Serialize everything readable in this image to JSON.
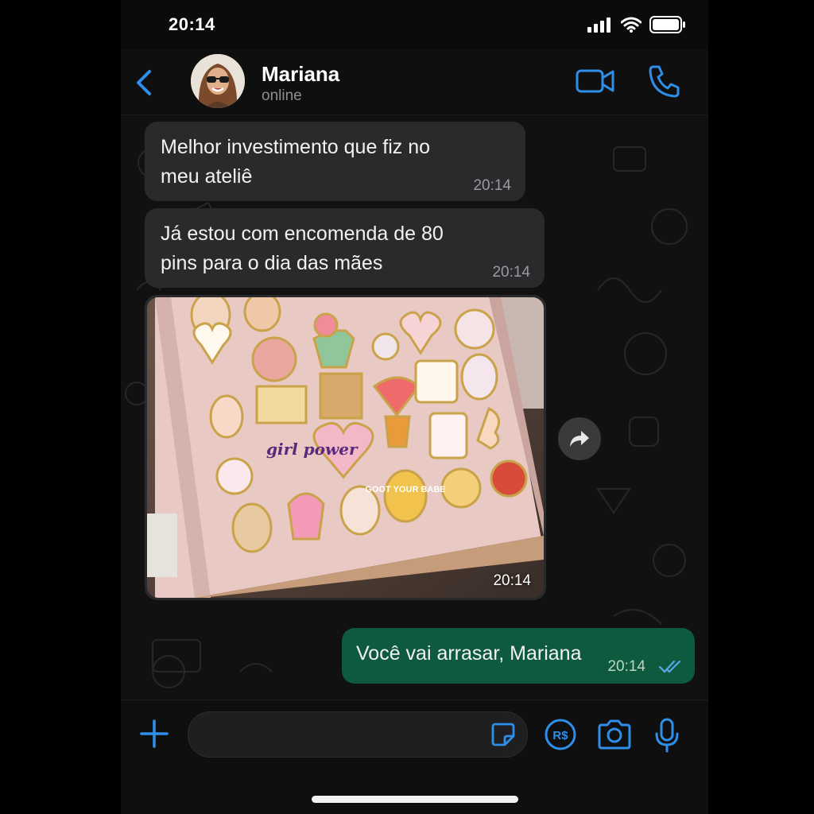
{
  "status_bar": {
    "time": "20:14"
  },
  "header": {
    "contact_name": "Mariana",
    "contact_status": "online"
  },
  "messages": [
    {
      "type": "text",
      "text_line1": "Melhor investimento que fiz no",
      "text_line2": "meu ateliê",
      "time": "20:14"
    },
    {
      "type": "text",
      "text_line1": "Já estou com encomenda de 80",
      "text_line2": "pins para o dia das mães",
      "time": "20:14"
    },
    {
      "type": "image",
      "time": "20:14",
      "pin_texts": {
        "girl_power": "girl power",
        "got_your_babe": "GOOT YOUR BABE"
      }
    },
    {
      "type": "outgoing",
      "text": "Você vai arrasar, Mariana",
      "time": "20:14"
    }
  ],
  "input": {
    "placeholder": ""
  },
  "colors": {
    "accent": "#2f8fe8",
    "outgoing_bubble": "#0e5a3e",
    "incoming_bubble": "#2a2a2c",
    "read_ticks": "#5aa6ea"
  },
  "icons": [
    "back-chevron-icon",
    "video-call-icon",
    "phone-call-icon",
    "forward-icon",
    "plus-icon",
    "sticker-icon",
    "payment-icon",
    "camera-icon",
    "microphone-icon",
    "double-check-icon",
    "signal-icon",
    "wifi-icon",
    "battery-icon"
  ]
}
